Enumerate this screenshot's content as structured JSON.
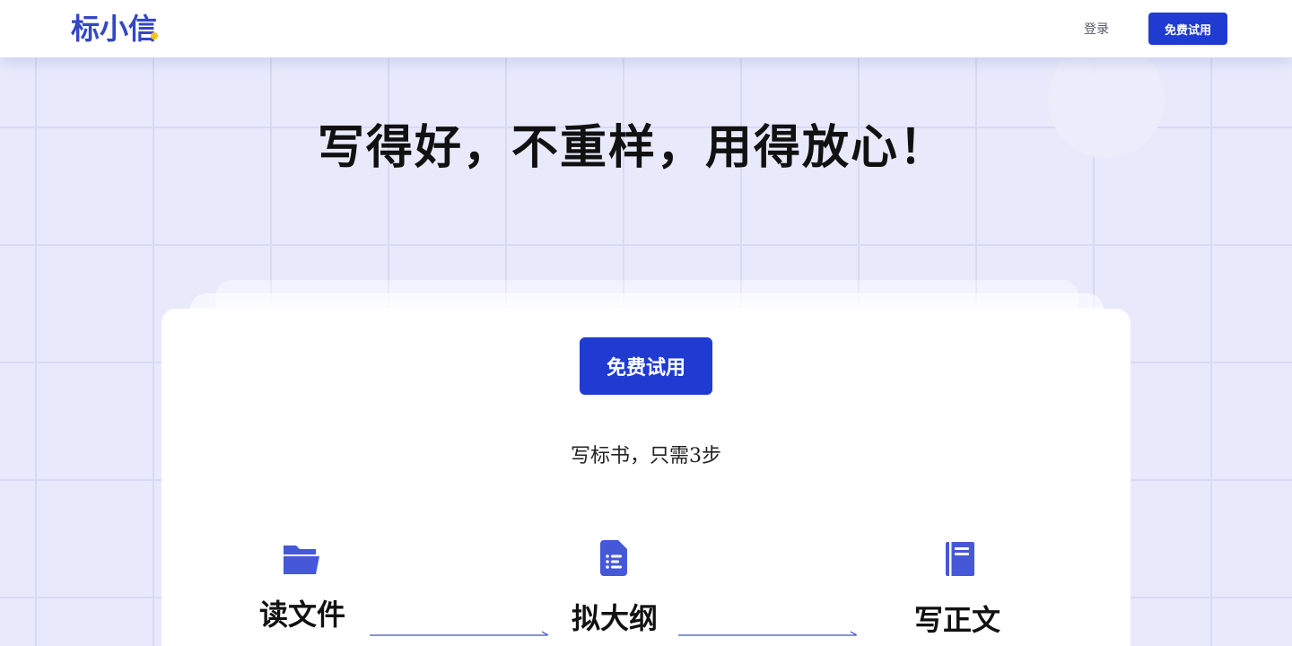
{
  "header": {
    "logo_text": "标小信",
    "login_label": "登录",
    "cta_label": "免费试用"
  },
  "hero": {
    "title": "写得好，不重样，用得放心！"
  },
  "card": {
    "cta_label": "免费试用",
    "subtitle": "写标书，只需3步",
    "steps": [
      {
        "label": "读文件",
        "icon": "folder-open-icon"
      },
      {
        "label": "拟大纲",
        "icon": "document-list-icon"
      },
      {
        "label": "写正文",
        "icon": "book-icon"
      }
    ]
  },
  "colors": {
    "brand": "#1f3bd1",
    "icon": "#4558d8",
    "background": "#e8eafc",
    "logo_dot": "#f5c518"
  }
}
